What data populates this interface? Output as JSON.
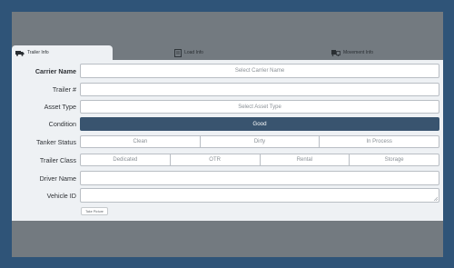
{
  "tabs": [
    {
      "label": "Trailer Info",
      "icon": "truck-icon"
    },
    {
      "label": "Load Info",
      "icon": "document-icon"
    },
    {
      "label": "Movement Info",
      "icon": "movement-icon"
    }
  ],
  "form": {
    "carrier": {
      "label": "Carrier Name",
      "placeholder": "Select Carrier Name"
    },
    "trailer": {
      "label": "Trailer #",
      "value": ""
    },
    "asset_type": {
      "label": "Asset Type",
      "placeholder": "Select Asset Type"
    },
    "condition": {
      "label": "Condition",
      "value": "Good"
    },
    "tanker_status": {
      "label": "Tanker Status",
      "options": [
        "Clean",
        "Dirty",
        "In Process"
      ]
    },
    "trailer_class": {
      "label": "Trailer Class",
      "options": [
        "Dedicated",
        "OTR",
        "Rental",
        "Storage"
      ]
    },
    "driver": {
      "label": "Driver Name",
      "value": ""
    },
    "vehicle": {
      "label": "Vehicle ID",
      "value": ""
    }
  },
  "take_picture_label": "Take Picture",
  "colors": {
    "background": "#2f5478",
    "frame": "#737a80",
    "panel": "#eef1f4",
    "selected": "#39546f"
  }
}
